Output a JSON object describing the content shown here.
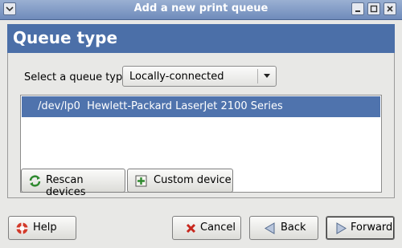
{
  "window": {
    "title": "Add a new print queue"
  },
  "banner": {
    "title": "Queue type"
  },
  "queue_type": {
    "label": "Select a queue type:",
    "selected": "Locally-connected"
  },
  "devices": [
    {
      "port": "/dev/lp0",
      "name": "Hewlett-Packard LaserJet 2100 Series",
      "selected": true
    }
  ],
  "buttons": {
    "rescan": "Rescan devices",
    "custom": "Custom device",
    "help": "Help",
    "cancel": "Cancel",
    "back": "Back",
    "forward": "Forward"
  },
  "colors": {
    "banner": "#4b6fa8",
    "selection": "#4f73ad",
    "titlebar": "#7f99c4"
  }
}
